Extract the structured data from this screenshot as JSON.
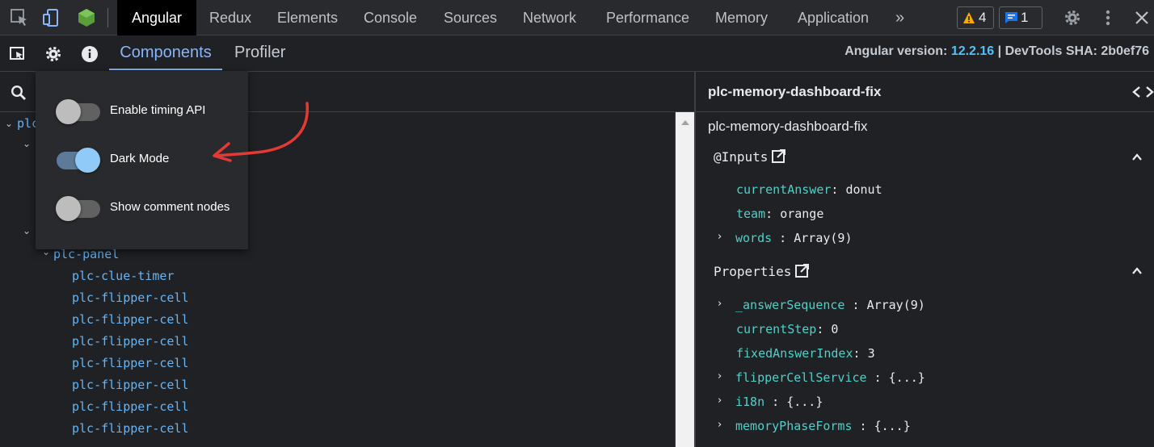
{
  "devtools_tabs": [
    "Redux",
    "Elements",
    "Console",
    "Sources",
    "Network",
    "Performance",
    "Memory",
    "Application"
  ],
  "active_tab": "Angular",
  "more_tabs": "»",
  "warnings_count": "4",
  "messages_count": "1",
  "angular_tabs": [
    "Components",
    "Profiler"
  ],
  "version": {
    "label": "Angular version:",
    "number": "12.2.16",
    "sha": "| DevTools SHA: 2b0ef76"
  },
  "settings": {
    "options": [
      {
        "label": "Enable timing API",
        "on": false
      },
      {
        "label": "Dark Mode",
        "on": true
      },
      {
        "label": "Show comment nodes",
        "on": false
      }
    ]
  },
  "tree": {
    "root_partial": "plc",
    "nodes": [
      "plc-panel",
      "plc-clue-timer",
      "plc-flipper-cell",
      "plc-flipper-cell",
      "plc-flipper-cell",
      "plc-flipper-cell",
      "plc-flipper-cell",
      "plc-flipper-cell",
      "plc-flipper-cell"
    ]
  },
  "details": {
    "title": "plc-memory-dashboard-fix",
    "subtitle": "plc-memory-dashboard-fix",
    "inputs_header": "@Inputs",
    "inputs": [
      {
        "key": "currentAnswer",
        "sep": ":",
        "value": "donut",
        "expandable": false
      },
      {
        "key": "team",
        "sep": ":",
        "value": "orange",
        "expandable": false
      },
      {
        "key": "words",
        "sep": " :",
        "value": "Array(9)",
        "expandable": true
      }
    ],
    "properties_header": "Properties",
    "properties": [
      {
        "key": "_answerSequence",
        "sep": " :",
        "value": "Array(9)",
        "expandable": true
      },
      {
        "key": "currentStep",
        "sep": ":",
        "value": "0",
        "expandable": false
      },
      {
        "key": "fixedAnswerIndex",
        "sep": ":",
        "value": "3",
        "expandable": false
      },
      {
        "key": "flipperCellService",
        "sep": " :",
        "value": "{...}",
        "expandable": true
      },
      {
        "key": "i18n",
        "sep": " :",
        "value": "{...}",
        "expandable": true
      },
      {
        "key": "memoryPhaseForms",
        "sep": " :",
        "value": "{...}",
        "expandable": true
      }
    ]
  },
  "colors": {
    "accent": "#8ab4f8",
    "version_number": "#4fc3f7",
    "tree_node": "#64b5f6",
    "prop_key": "#4dd0c8",
    "annotation": "#e53935"
  }
}
